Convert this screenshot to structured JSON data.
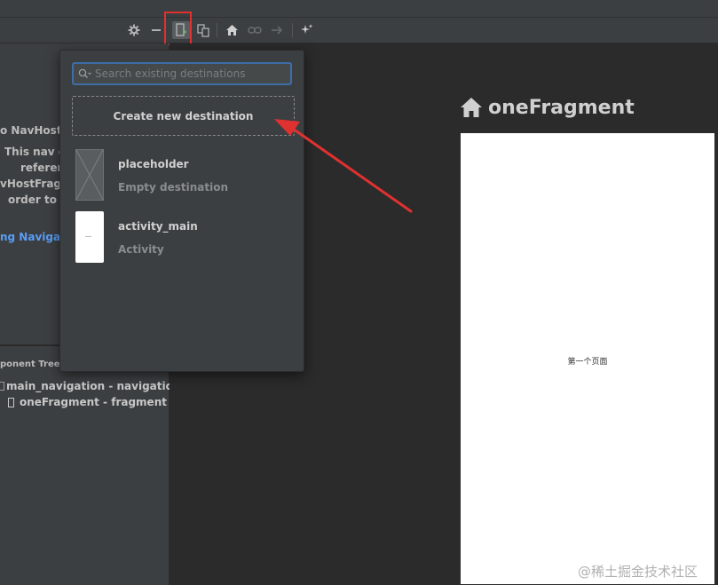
{
  "toolbar": {
    "icons": [
      "gear-icon",
      "minus-icon",
      "new-destination-icon",
      "copy-icon",
      "home-icon",
      "link-icon",
      "arrow-right-icon",
      "magic-wand-icon"
    ]
  },
  "left_panel": {
    "lines": [
      "o NavHostF",
      "This nav g",
      "referen",
      "vHostFragm",
      "order to b"
    ],
    "link": "ng Navigat"
  },
  "component_tree": {
    "header": "ponent Tree",
    "items": [
      {
        "label": "main_navigation - navigation"
      },
      {
        "label": "oneFragment - fragment"
      }
    ]
  },
  "popup": {
    "search_placeholder": "Search existing destinations",
    "search_value": "",
    "create_label": "Create new destination",
    "destinations": [
      {
        "name": "placeholder",
        "type": "Empty destination"
      },
      {
        "name": "activity_main",
        "type": "Activity"
      }
    ]
  },
  "canvas": {
    "fragment_title": "oneFragment",
    "fragment_text": "第一个页面"
  },
  "annotation": {
    "color": "#e03131"
  },
  "watermark": "@稀土掘金技术社区"
}
